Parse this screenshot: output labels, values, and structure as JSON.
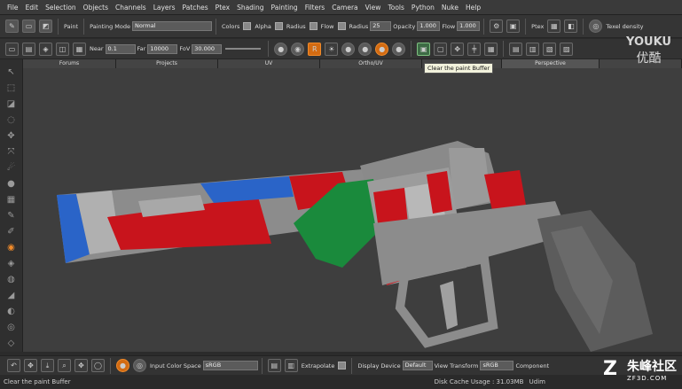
{
  "menu": [
    "File",
    "Edit",
    "Selection",
    "Objects",
    "Channels",
    "Layers",
    "Patches",
    "Ptex",
    "Shading",
    "Painting",
    "Filters",
    "Camera",
    "View",
    "Tools",
    "Python",
    "Nuke",
    "Help"
  ],
  "toolbar1": {
    "paint_label": "Paint",
    "painting_mode_label": "Painting Mode",
    "painting_mode_value": "Normal",
    "colors_label": "Colors",
    "alpha_label": "Alpha",
    "radius_label": "Radius",
    "flow_label": "Flow",
    "radius2_label": "Radius",
    "radius2_value": "25",
    "opacity_label": "Opacity",
    "opacity_value": "1.000",
    "flow2_label": "Flow",
    "flow2_value": "1.000",
    "ptex_label": "Ptex",
    "texel_label": "Texel density"
  },
  "toolbar2": {
    "near_label": "Near",
    "near_value": "0.1",
    "far_label": "Far",
    "far_value": "10000",
    "fov_label": "FoV",
    "fov_value": "30.000"
  },
  "view_tabs": [
    "Forums",
    "Projects",
    "UV",
    "Ortho/UV",
    "",
    "Perspective",
    ""
  ],
  "tooltip": "Clear the paint Buffer",
  "bottom": {
    "input_cs_label": "Input Color Space",
    "input_cs_value": "sRGB",
    "extrapolate_label": "Extrapolate",
    "display_device_label": "Display Device",
    "display_device_value": "Default",
    "view_transform_label": "View Transform",
    "view_transform_value": "sRGB",
    "component_label": "Component"
  },
  "status": {
    "left": "Clear the paint Buffer",
    "disk_cache": "Disk Cache Usage : 31.03MB",
    "udim": "Udim"
  },
  "watermarks": {
    "youku_en": "YOUKU",
    "youku_cn": "优酷",
    "zf_cn": "朱峰社区",
    "zf_en": "ZF3D.COM"
  },
  "colors": {
    "paint_red": "#c8141c",
    "paint_green": "#1a8a3c",
    "paint_blue": "#2a64c8",
    "gun_grey": "#8c8c8c",
    "accent_orange": "#e07a1a"
  }
}
